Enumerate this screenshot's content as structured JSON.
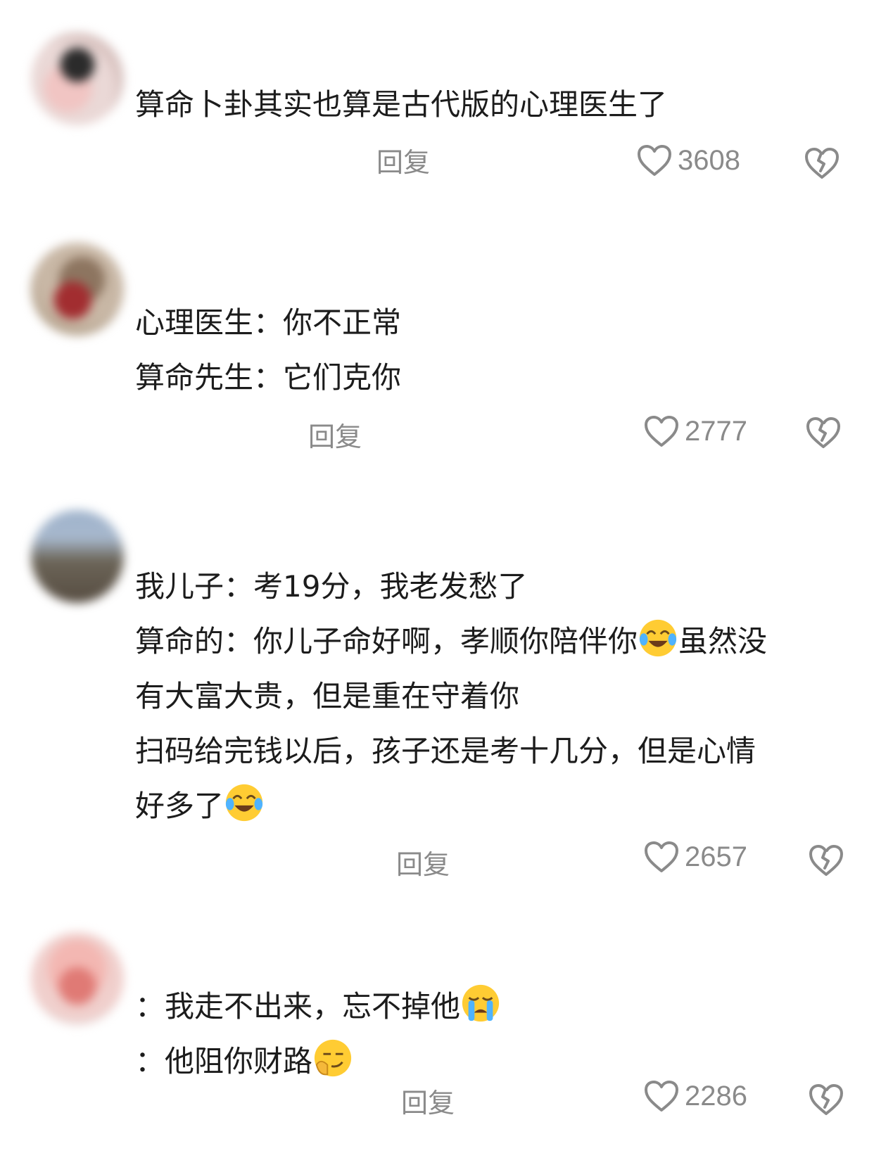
{
  "comments": [
    {
      "lines": [
        "算命卜卦其实也算是古代版的心理医生了"
      ],
      "reply_label": "回复",
      "likes": "3608"
    },
    {
      "lines": [
        "心理医生：你不正常",
        "算命先生：它们克你"
      ],
      "reply_label": "回复",
      "likes": "2777"
    },
    {
      "lines": [
        "我儿子：考19分，我老发愁了",
        "算命的：你儿子命好啊，孝顺你陪伴你",
        "虽然没",
        "有大富大贵，但是重在守着你",
        "扫码给完钱以后，孩子还是考十几分，但是心情",
        "好多了"
      ],
      "reply_label": "回复",
      "likes": "2657"
    },
    {
      "lines": [
        "：我走不出来，忘不掉他",
        "：他阻你财路"
      ],
      "reply_label": "回复",
      "likes": "2286"
    }
  ],
  "icons": {
    "like": "heart-outline-icon",
    "dislike": "broken-heart-icon",
    "emoji_crying_laugh": "tears-of-joy-emoji",
    "emoji_sob": "loudly-crying-emoji",
    "emoji_smirk": "thinking-smirk-emoji"
  },
  "colors": {
    "text": "#1c1c1c",
    "meta": "#8a8a8a",
    "background": "#ffffff"
  }
}
